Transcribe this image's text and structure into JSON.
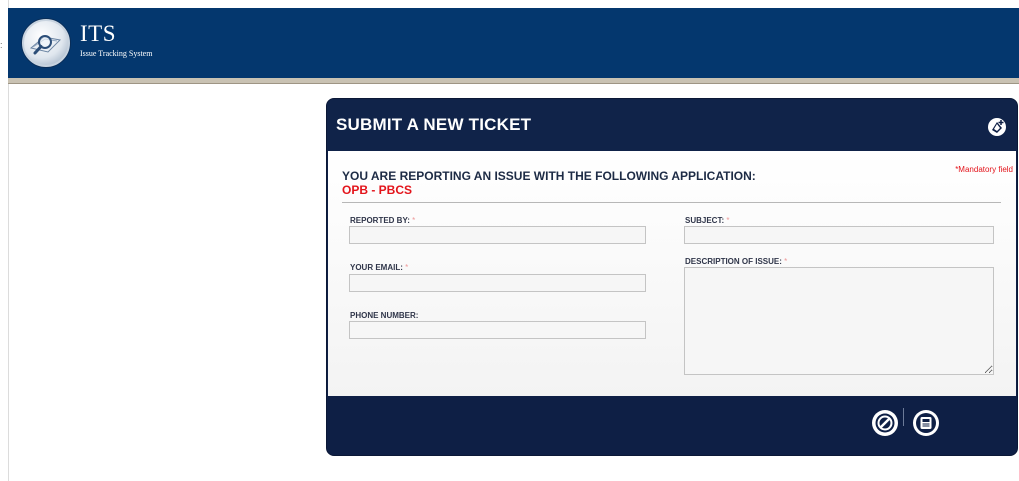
{
  "header": {
    "title": "ITS",
    "subtitle": "Issue Tracking System",
    "logo_icon": "magnifier-document-logo",
    "bg_color": "#04376e"
  },
  "form": {
    "title": "SUBMIT A NEW TICKET",
    "title_icon": "new-ticket-icon",
    "application_label": "YOU ARE REPORTING AN ISSUE WITH THE FOLLOWING APPLICATION:",
    "application_name": "OPB - PBCS",
    "mandatory_note": "*Mandatory field",
    "required_marker": "*",
    "fields": {
      "reported_by": {
        "label": "REPORTED BY:",
        "value": ""
      },
      "your_email": {
        "label": "YOUR EMAIL:",
        "value": ""
      },
      "phone_number": {
        "label": "PHONE NUMBER:",
        "value": ""
      },
      "subject": {
        "label": "SUBJECT:",
        "value": ""
      },
      "description": {
        "label": "DESCRIPTION OF ISSUE:",
        "value": ""
      }
    },
    "actions": {
      "cancel_icon": "cancel-icon",
      "save_icon": "save-icon"
    },
    "colors": {
      "panel": "#0e1f45",
      "mandatory": "#e3141b",
      "app_name": "#e3141b"
    }
  }
}
